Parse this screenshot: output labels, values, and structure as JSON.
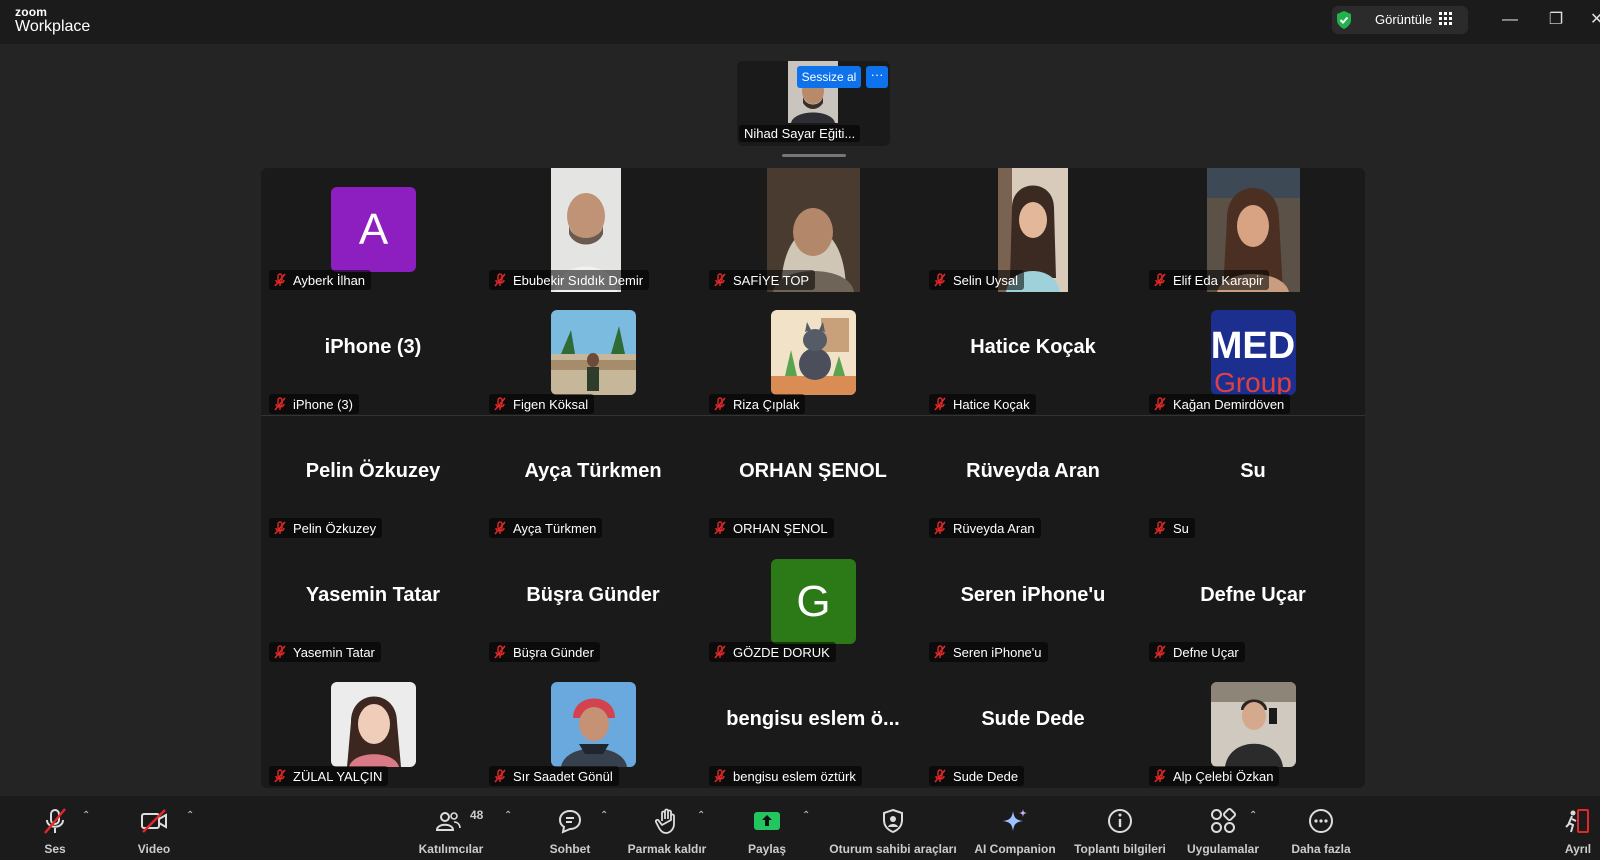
{
  "app": {
    "brand_small": "zoom",
    "brand_large": "Workplace"
  },
  "titlebar": {
    "view_label": "Görüntüle"
  },
  "speaker": {
    "name": "Nihad Sayar Eğiti...",
    "mute_label": "Sessize al",
    "more_label": "···"
  },
  "participants": [
    {
      "name": "Ayberk İlhan",
      "type": "letter",
      "letter": "A",
      "color": "#8d1fc1"
    },
    {
      "name": "Ebubekir Sıddık Demir",
      "type": "video"
    },
    {
      "name": "SAFİYE TOP",
      "type": "video"
    },
    {
      "name": "Selin Uysal",
      "type": "video"
    },
    {
      "name": "Elif Eda Karapir",
      "type": "video"
    },
    {
      "name": "iPhone (3)",
      "type": "text",
      "display": "iPhone (3)"
    },
    {
      "name": "Figen Köksal",
      "type": "photo"
    },
    {
      "name": "Riza Çıplak",
      "type": "photo"
    },
    {
      "name": "Hatice Koçak",
      "type": "text",
      "display": "Hatice Koçak"
    },
    {
      "name": "Kağan Demirdöven",
      "type": "logo",
      "logo_text": "MED Group"
    },
    {
      "name": "Pelin Özkuzey",
      "type": "text",
      "display": "Pelin Özkuzey"
    },
    {
      "name": "Ayça Türkmen",
      "type": "text",
      "display": "Ayça Türkmen"
    },
    {
      "name": "ORHAN ŞENOL",
      "type": "text",
      "display": "ORHAN ŞENOL"
    },
    {
      "name": "Rüveyda Aran",
      "type": "text",
      "display": "Rüveyda Aran"
    },
    {
      "name": "Su",
      "type": "text",
      "display": "Su"
    },
    {
      "name": "Yasemin Tatar",
      "type": "text",
      "display": "Yasemin Tatar"
    },
    {
      "name": "Büşra Günder",
      "type": "text",
      "display": "Büşra Günder"
    },
    {
      "name": "GÖZDE DORUK",
      "type": "letter",
      "letter": "G",
      "color": "#2b7a17"
    },
    {
      "name": "Seren iPhone'u",
      "type": "text",
      "display": "Seren iPhone'u"
    },
    {
      "name": "Defne Uçar",
      "type": "text",
      "display": "Defne Uçar"
    },
    {
      "name": "ZÜLAL YALÇIN",
      "type": "photo"
    },
    {
      "name": "Sır Saadet Gönül",
      "type": "photo"
    },
    {
      "name": "bengisu eslem öztürk",
      "type": "text",
      "display": "bengisu eslem ö..."
    },
    {
      "name": "Sude Dede",
      "type": "text",
      "display": "Sude Dede"
    },
    {
      "name": "Alp Çelebi Özkan",
      "type": "photo"
    }
  ],
  "toolbar": {
    "audio": "Ses",
    "video": "Video",
    "participants": "Katılımcılar",
    "participant_count": "48",
    "chat": "Sohbet",
    "raise_hand": "Parmak kaldır",
    "share": "Paylaş",
    "host_tools": "Oturum sahibi araçları",
    "ai_companion": "AI Companion",
    "meeting_info": "Toplantı bilgileri",
    "apps": "Uygulamalar",
    "more": "Daha fazla",
    "leave": "Ayrıl"
  },
  "colors": {
    "accent_blue": "#0e72ed",
    "mute_red": "#e02828",
    "share_green": "#22c55e"
  }
}
